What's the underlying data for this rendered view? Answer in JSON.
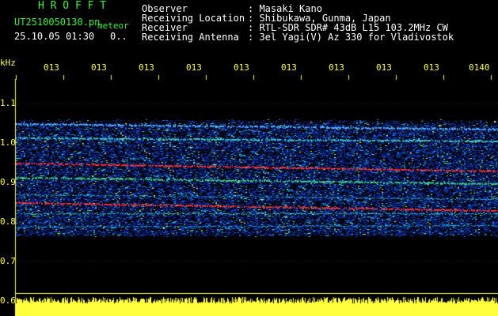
{
  "header": {
    "brand": "H R O F F T",
    "filename": "UT2510050130.pn",
    "mode": "meteor",
    "datetime": "25.10.05 01:30",
    "count": "0.."
  },
  "info": {
    "labels": [
      "Observer",
      "Receiving Location",
      "Receiver",
      "Receiving Antenna"
    ],
    "values": [
      ": Masaki Kano",
      ": Shibukawa, Gunma, Japan",
      ": RTL-SDR SDR# 43dB L15 103.2MHz CW",
      ": 3el Yagi(V) Az 330 for Vladivostok"
    ]
  },
  "yaxis": {
    "unit": "kHz",
    "ticks": [
      "1.1",
      "1.0",
      "0.9",
      "0.8",
      "0.7",
      "0.6"
    ]
  },
  "xaxis": {
    "ticks": [
      "013",
      "013",
      "013",
      "013",
      "013",
      "013",
      "013",
      "013",
      "013",
      "0140"
    ]
  },
  "colors": {
    "background": "#000000",
    "header_green": "#3ff03f",
    "label_yellow": "#ffff3c",
    "signal_red": "#ff2020",
    "noise_blue": "#0a2aa0"
  }
}
